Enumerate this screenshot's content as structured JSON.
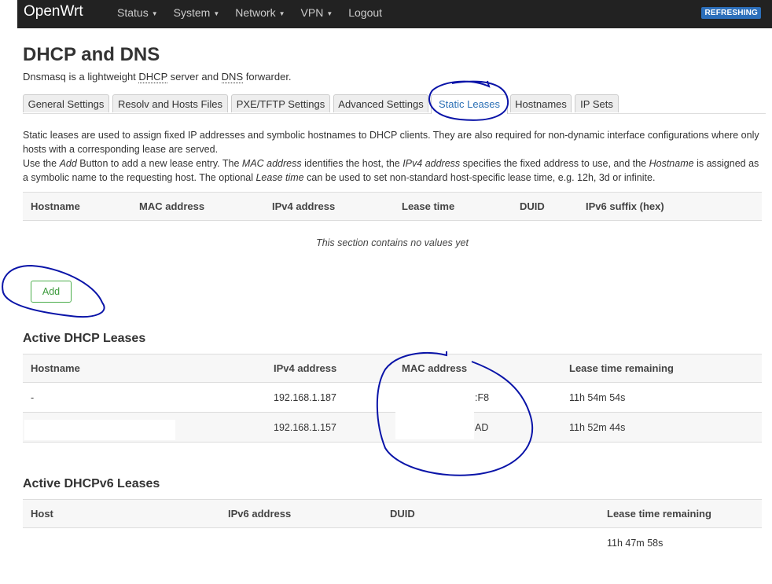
{
  "navbar": {
    "brand": "OpenWrt",
    "menu": [
      "Status",
      "System",
      "Network",
      "VPN",
      "Logout"
    ],
    "badge": "REFRESHING"
  },
  "page": {
    "title": "DHCP and DNS",
    "subtitle_pre": "Dnsmasq is a lightweight ",
    "subtitle_dhcp": "DHCP",
    "subtitle_mid": " server and ",
    "subtitle_dns": "DNS",
    "subtitle_post": " forwarder."
  },
  "tabs": [
    {
      "label": "General Settings"
    },
    {
      "label": "Resolv and Hosts Files"
    },
    {
      "label": "PXE/TFTP Settings"
    },
    {
      "label": "Advanced Settings"
    },
    {
      "label": "Static Leases"
    },
    {
      "label": "Hostnames"
    },
    {
      "label": "IP Sets"
    }
  ],
  "active_tab": "Static Leases",
  "description": {
    "line1": "Static leases are used to assign fixed IP addresses and symbolic hostnames to DHCP clients. They are also required for non-dynamic interface configurations where only hosts with a corresponding lease are served.",
    "p2_a": "Use the ",
    "p2_add": "Add",
    "p2_b": " Button to add a new lease entry. The ",
    "p2_mac": "MAC address",
    "p2_c": " identifies the host, the ",
    "p2_ipv4": "IPv4 address",
    "p2_d": " specifies the fixed address to use, and the ",
    "p2_hostname": "Hostname",
    "p2_e": " is assigned as a symbolic name to the requesting host. The optional ",
    "p2_lease": "Lease time",
    "p2_f": " can be used to set non-standard host-specific lease time, e.g. 12h, 3d or infinite."
  },
  "static_table": {
    "headers": [
      "Hostname",
      "MAC address",
      "IPv4 address",
      "Lease time",
      "DUID",
      "IPv6 suffix (hex)"
    ],
    "empty_text": "This section contains no values yet",
    "add_label": "Add"
  },
  "dhcp_leases": {
    "title": "Active DHCP Leases",
    "headers": [
      "Hostname",
      "IPv4 address",
      "MAC address",
      "Lease time remaining"
    ],
    "rows": [
      {
        "hostname": "-",
        "ipv4": "192.168.1.187",
        "mac": ":F8",
        "remaining": "11h 54m 54s"
      },
      {
        "hostname": "",
        "ipv4": "192.168.1.157",
        "mac": "AD",
        "remaining": "11h 52m 44s"
      }
    ]
  },
  "dhcpv6_leases": {
    "title": "Active DHCPv6 Leases",
    "headers": [
      "Host",
      "IPv6 address",
      "DUID",
      "Lease time remaining"
    ],
    "rows": [
      {
        "host": "",
        "ipv6": "",
        "duid": "",
        "remaining": "11h 47m 58s"
      }
    ]
  },
  "colors": {
    "navbar": "#222222",
    "badge": "#2c6fbb",
    "active_tab": "#2a6fb5",
    "add_button": "#4cae4c",
    "annotation": "#0a14a8"
  }
}
